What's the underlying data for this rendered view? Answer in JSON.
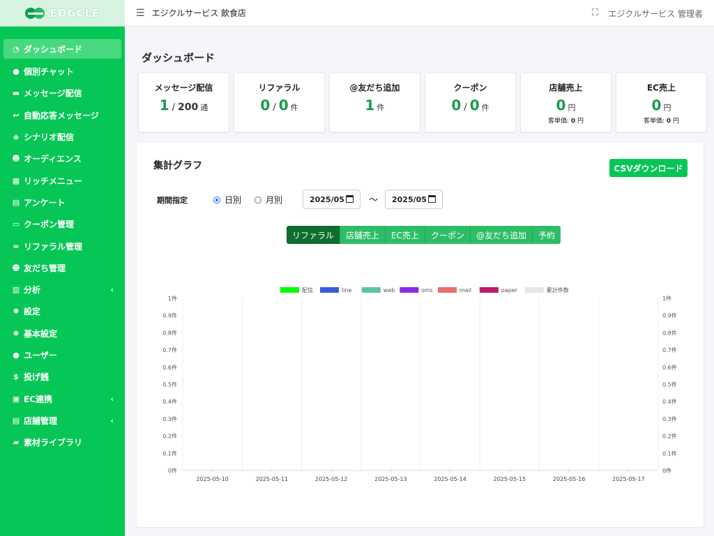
{
  "brand": {
    "name": "EDGCLE"
  },
  "sidebar": {
    "items": [
      {
        "label": "ダッシュボード",
        "icon": "gauge-icon",
        "glyph": "◔",
        "active": true
      },
      {
        "label": "個別チャット",
        "icon": "comment-icon",
        "glyph": "●"
      },
      {
        "label": "メッセージ配信",
        "icon": "message-icon",
        "glyph": "▬"
      },
      {
        "label": "自動応答メッセージ",
        "icon": "reply-icon",
        "glyph": "↩"
      },
      {
        "label": "シナリオ配信",
        "icon": "layers-icon",
        "glyph": "◈"
      },
      {
        "label": "オーディエンス",
        "icon": "users-icon",
        "glyph": "☻"
      },
      {
        "label": "リッチメニュー",
        "icon": "table-icon",
        "glyph": "▦"
      },
      {
        "label": "アンケート",
        "icon": "poll-icon",
        "glyph": "▤"
      },
      {
        "label": "クーポン管理",
        "icon": "ticket-icon",
        "glyph": "▭"
      },
      {
        "label": "リファラル管理",
        "icon": "link-icon",
        "glyph": "∞"
      },
      {
        "label": "友だち管理",
        "icon": "user-group-icon",
        "glyph": "☻"
      },
      {
        "label": "分析",
        "icon": "chart-icon",
        "glyph": "▥",
        "chevron": true
      },
      {
        "label": "設定",
        "icon": "gear-icon",
        "glyph": "✹"
      },
      {
        "label": "基本設定",
        "icon": "gear-icon",
        "glyph": "✹"
      },
      {
        "label": "ユーザー",
        "icon": "user-icon",
        "glyph": "●"
      },
      {
        "label": "投げ銭",
        "icon": "dollar-icon",
        "glyph": "$"
      },
      {
        "label": "EC連携",
        "icon": "bag-icon",
        "glyph": "▣",
        "chevron": true
      },
      {
        "label": "店舗管理",
        "icon": "store-icon",
        "glyph": "▤",
        "chevron": true
      },
      {
        "label": "素材ライブラリ",
        "icon": "folder-icon",
        "glyph": "▰"
      }
    ]
  },
  "header": {
    "title": "エジクルサービス 飲食店",
    "user": "エジクルサービス 管理者"
  },
  "page": {
    "title": "ダッシュボード"
  },
  "stats": [
    {
      "label": "メッセージ配信",
      "value": "1",
      "sep": "/",
      "value2": "200",
      "unit": "通"
    },
    {
      "label": "リファラル",
      "value": "0",
      "sep": "/",
      "value2": "0",
      "unit": "件",
      "big2": true
    },
    {
      "label": "@友だち追加",
      "value": "1",
      "unit": "件"
    },
    {
      "label": "クーポン",
      "value": "0",
      "sep": "/",
      "value2": "0",
      "unit": "件",
      "big2": true
    },
    {
      "label": "店舗売上",
      "value": "0",
      "unit": "円",
      "sub_label": "客単価:",
      "sub_value": "0",
      "sub_unit": "円"
    },
    {
      "label": "EC売上",
      "value": "0",
      "unit": "円",
      "sub_label": "客単価:",
      "sub_value": "0",
      "sub_unit": "円"
    }
  ],
  "graph": {
    "title": "集計グラフ",
    "csv_label": "CSVダウンロード",
    "period_label": "期間指定",
    "radio_daily": "日別",
    "radio_monthly": "月別",
    "date_from": "2025/05",
    "tilde": "〜",
    "date_to": "2025/05",
    "tabs": [
      "リファラル",
      "店舗売上",
      "EC売上",
      "クーポン",
      "@友だち追加",
      "予約"
    ],
    "active_tab": 0
  },
  "chart_data": {
    "type": "line",
    "x": [
      "2025-05-10",
      "2025-05-11",
      "2025-05-12",
      "2025-05-13",
      "2025-05-14",
      "2025-05-15",
      "2025-05-16",
      "2025-05-17"
    ],
    "series": [
      {
        "name": "配信",
        "color": "#00ff00",
        "values": [
          0,
          0,
          0,
          0,
          0,
          0,
          0,
          0
        ]
      },
      {
        "name": "line",
        "color": "#3b5bdb",
        "values": [
          0,
          0,
          0,
          0,
          0,
          0,
          0,
          0
        ]
      },
      {
        "name": "web",
        "color": "#5fc2a0",
        "values": [
          0,
          0,
          0,
          0,
          0,
          0,
          0,
          0
        ]
      },
      {
        "name": "sms",
        "color": "#8a2be2",
        "values": [
          0,
          0,
          0,
          0,
          0,
          0,
          0,
          0
        ]
      },
      {
        "name": "mail",
        "color": "#e87070",
        "values": [
          0,
          0,
          0,
          0,
          0,
          0,
          0,
          0
        ]
      },
      {
        "name": "paper",
        "color": "#c0186e",
        "values": [
          0,
          0,
          0,
          0,
          0,
          0,
          0,
          0
        ]
      },
      {
        "name": "累計件数",
        "color": "#e6e6e6",
        "values": [
          0,
          0,
          0,
          0,
          0,
          0,
          0,
          0
        ]
      }
    ],
    "yticks": [
      "0件",
      "0.1件",
      "0.2件",
      "0.3件",
      "0.4件",
      "0.5件",
      "0.6件",
      "0.7件",
      "0.8件",
      "0.9件",
      "1件"
    ],
    "ylim": [
      0,
      1
    ],
    "legend": "top",
    "grid": true
  }
}
